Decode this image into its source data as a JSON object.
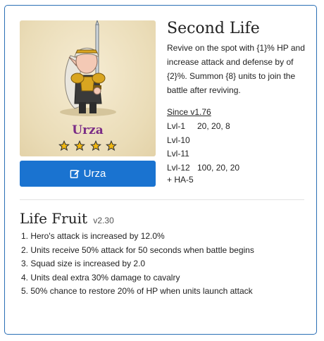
{
  "hero": {
    "name": "Urza",
    "stars": 4,
    "button_label": "Urza",
    "button_icon": "edit-icon"
  },
  "skill": {
    "title": "Second Life",
    "description": "Revive on the spot with {1}% HP and increase attack and defense by of {2}%. Summon {8} units to join the battle after reviving.",
    "since": "Since v1.76",
    "levels": [
      {
        "name": "Lvl-1",
        "values": "20, 20, 8"
      },
      {
        "name": "Lvl-10",
        "values": ""
      },
      {
        "name": "Lvl-11",
        "values": ""
      },
      {
        "name": "Lvl-12",
        "values": "100, 20, 20"
      }
    ],
    "ha": "+ HA-5"
  },
  "life_fruit": {
    "title": "Life Fruit",
    "version": "v2.30",
    "items": [
      "1. Hero's attack is increased by 12.0%",
      "2. Units receive 50% attack for 50 seconds when battle begins",
      "3. Squad size is increased by 2.0",
      "4. Units deal extra 30% damage to cavalry",
      "5. 50% chance to restore 20% of HP when units launch attack"
    ]
  },
  "colors": {
    "accent": "#1a73d0",
    "border": "#2a6fb5",
    "hero_name": "#7a2c86",
    "star": "#f2b80f"
  }
}
